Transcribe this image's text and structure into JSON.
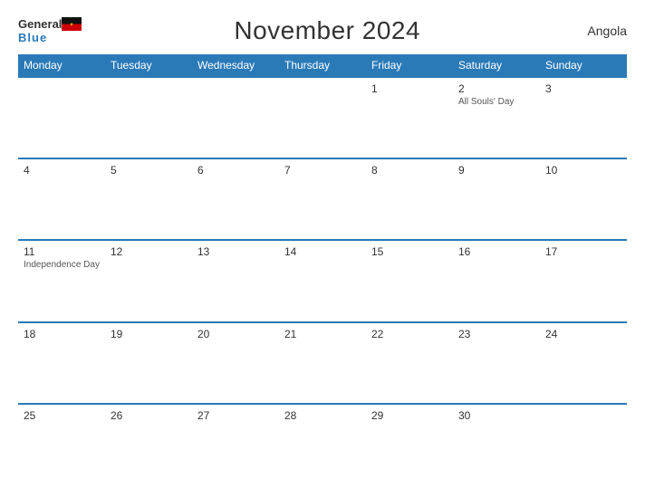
{
  "header": {
    "logo_general": "General",
    "logo_blue": "Blue",
    "title": "November 2024",
    "country": "Angola"
  },
  "weekdays": [
    "Monday",
    "Tuesday",
    "Wednesday",
    "Thursday",
    "Friday",
    "Saturday",
    "Sunday"
  ],
  "weeks": [
    [
      {
        "day": "",
        "holiday": ""
      },
      {
        "day": "",
        "holiday": ""
      },
      {
        "day": "",
        "holiday": ""
      },
      {
        "day": "",
        "holiday": ""
      },
      {
        "day": "1",
        "holiday": ""
      },
      {
        "day": "2",
        "holiday": "All Souls' Day"
      },
      {
        "day": "3",
        "holiday": ""
      }
    ],
    [
      {
        "day": "4",
        "holiday": ""
      },
      {
        "day": "5",
        "holiday": ""
      },
      {
        "day": "6",
        "holiday": ""
      },
      {
        "day": "7",
        "holiday": ""
      },
      {
        "day": "8",
        "holiday": ""
      },
      {
        "day": "9",
        "holiday": ""
      },
      {
        "day": "10",
        "holiday": ""
      }
    ],
    [
      {
        "day": "11",
        "holiday": "Independence Day"
      },
      {
        "day": "12",
        "holiday": ""
      },
      {
        "day": "13",
        "holiday": ""
      },
      {
        "day": "14",
        "holiday": ""
      },
      {
        "day": "15",
        "holiday": ""
      },
      {
        "day": "16",
        "holiday": ""
      },
      {
        "day": "17",
        "holiday": ""
      }
    ],
    [
      {
        "day": "18",
        "holiday": ""
      },
      {
        "day": "19",
        "holiday": ""
      },
      {
        "day": "20",
        "holiday": ""
      },
      {
        "day": "21",
        "holiday": ""
      },
      {
        "day": "22",
        "holiday": ""
      },
      {
        "day": "23",
        "holiday": ""
      },
      {
        "day": "24",
        "holiday": ""
      }
    ],
    [
      {
        "day": "25",
        "holiday": ""
      },
      {
        "day": "26",
        "holiday": ""
      },
      {
        "day": "27",
        "holiday": ""
      },
      {
        "day": "28",
        "holiday": ""
      },
      {
        "day": "29",
        "holiday": ""
      },
      {
        "day": "30",
        "holiday": ""
      },
      {
        "day": "",
        "holiday": ""
      }
    ]
  ]
}
